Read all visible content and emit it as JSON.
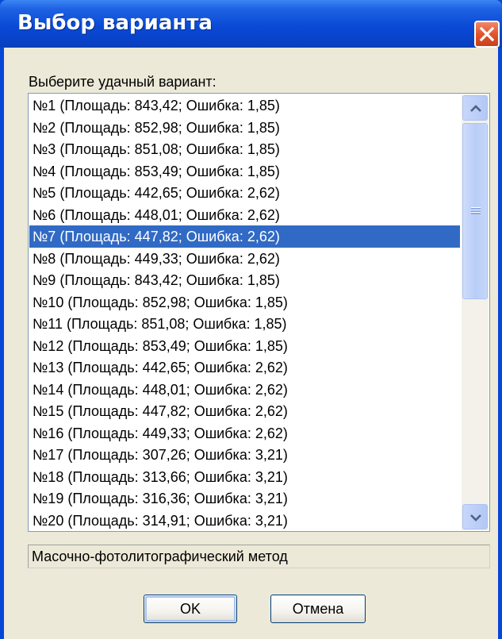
{
  "window": {
    "title": "Выбор варианта"
  },
  "dialog": {
    "prompt": "Выберите удачный вариант:",
    "selected_index": 6,
    "items": [
      "№1 (Площадь: 843,42; Ошибка: 1,85)",
      "№2 (Площадь: 852,98; Ошибка: 1,85)",
      "№3 (Площадь: 851,08; Ошибка: 1,85)",
      "№4 (Площадь: 853,49; Ошибка: 1,85)",
      "№5 (Площадь: 442,65; Ошибка: 2,62)",
      "№6 (Площадь: 448,01; Ошибка: 2,62)",
      "№7 (Площадь: 447,82; Ошибка: 2,62)",
      "№8 (Площадь: 449,33; Ошибка: 2,62)",
      "№9 (Площадь: 843,42; Ошибка: 1,85)",
      "№10 (Площадь: 852,98; Ошибка: 1,85)",
      "№11 (Площадь: 851,08; Ошибка: 1,85)",
      "№12 (Площадь: 853,49; Ошибка: 1,85)",
      "№13 (Площадь: 442,65; Ошибка: 2,62)",
      "№14 (Площадь: 448,01; Ошибка: 2,62)",
      "№15 (Площадь: 447,82; Ошибка: 2,62)",
      "№16 (Площадь: 449,33; Ошибка: 2,62)",
      "№17 (Площадь: 307,26; Ошибка: 3,21)",
      "№18 (Площадь: 313,66; Ошибка: 3,21)",
      "№19 (Площадь: 316,36; Ошибка: 3,21)",
      "№20 (Площадь: 314,91; Ошибка: 3,21)"
    ],
    "method_label": "Масочно-фотолитографический метод",
    "ok_label": "OK",
    "cancel_label": "Отмена"
  },
  "colors": {
    "titlebar": "#0a4ad6",
    "selection": "#316ac5",
    "dialog_bg": "#ece9d8",
    "close_button": "#e2552c"
  },
  "icons": {
    "close": "close-icon",
    "scroll_up": "chevron-up-icon",
    "scroll_down": "chevron-down-icon"
  }
}
